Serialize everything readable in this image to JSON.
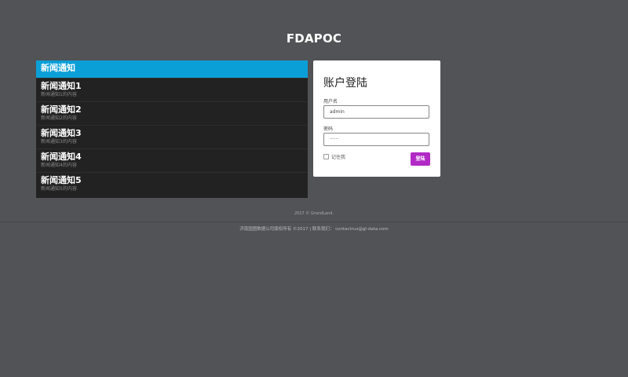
{
  "header": {
    "title": "FDAPOC"
  },
  "news": {
    "header": "新闻通知",
    "items": [
      {
        "title": "新闻通知1",
        "content": "新闻通知1的内容"
      },
      {
        "title": "新闻通知2",
        "content": "新闻通知2的内容"
      },
      {
        "title": "新闻通知3",
        "content": "新闻通知3的内容"
      },
      {
        "title": "新闻通知4",
        "content": "新闻通知4的内容"
      },
      {
        "title": "新闻通知5",
        "content": "新闻通知5的内容"
      }
    ]
  },
  "login": {
    "title": "账户登陆",
    "username_label": "用户名",
    "username_value": "admin",
    "password_label": "密码",
    "password_value": "······",
    "remember_label": "记住我",
    "submit_label": "登陆",
    "accent_color": "#b12ac6"
  },
  "footer": {
    "copyright": "2017 © GrandLand.",
    "company": "济南国图数据公司版权所有 ©2017 | 联系我们： contactrus@gl-data.com"
  },
  "colors": {
    "background": "#525356",
    "news_header": "#0b9fd8",
    "news_panel": "#222222"
  }
}
